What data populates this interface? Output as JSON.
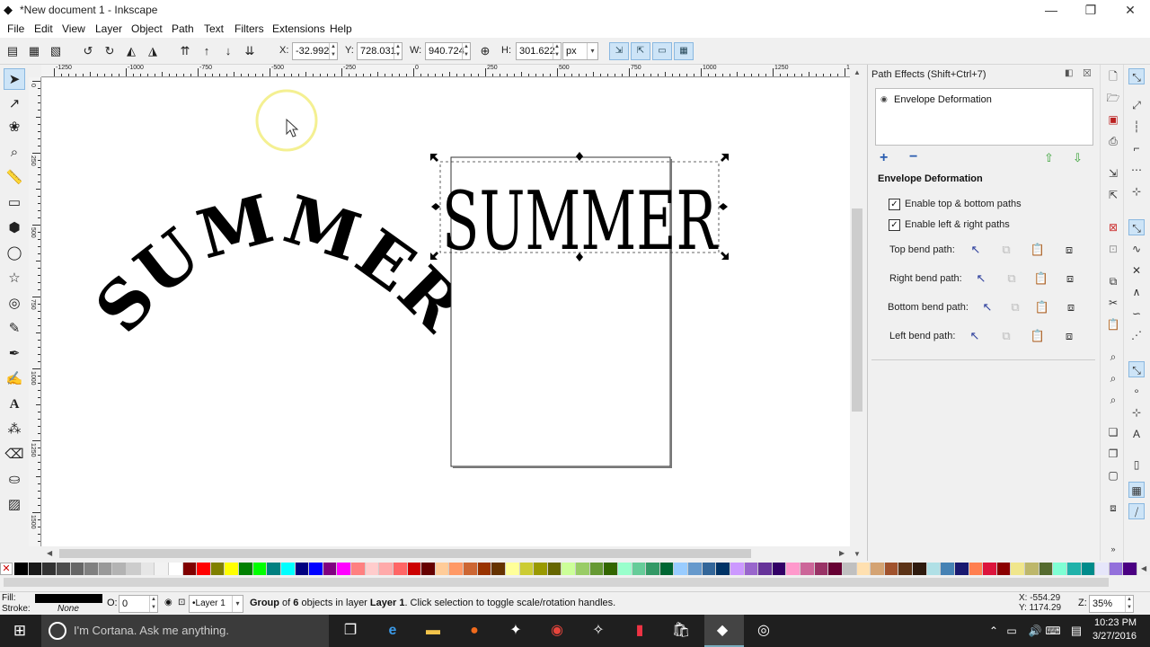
{
  "window": {
    "title": "*New document 1 - Inkscape",
    "minimize": "—",
    "restore": "❐",
    "close": "✕"
  },
  "menu": [
    "File",
    "Edit",
    "View",
    "Layer",
    "Object",
    "Path",
    "Text",
    "Filters",
    "Extensions",
    "Help"
  ],
  "toolbar": {
    "x_label": "X:",
    "x_value": "-32.992",
    "y_label": "Y:",
    "y_value": "728.031",
    "w_label": "W:",
    "w_value": "940.724",
    "h_label": "H:",
    "h_value": "301.622",
    "unit": "px"
  },
  "ruler": {
    "h_labels": [
      "-1250",
      "-1000",
      "-750",
      "-500",
      "-250",
      "0",
      "250",
      "500",
      "750",
      "1000",
      "1250",
      "1500",
      "1750"
    ],
    "v_labels": [
      "0",
      "250",
      "500",
      "750",
      "1000",
      "1250",
      "1500"
    ]
  },
  "canvas": {
    "text_arched": "SUMMER",
    "text_envelope": "SUMMER"
  },
  "panel": {
    "title": "Path Effects  (Shift+Ctrl+7)",
    "effect_item": "Envelope Deformation",
    "section_title": "Envelope Deformation",
    "enable_top_bottom": "Enable top & bottom paths",
    "enable_left_right": "Enable left & right paths",
    "top_bend": "Top bend path:",
    "right_bend": "Right bend path:",
    "bottom_bend": "Bottom bend path:",
    "left_bend": "Left bend path:"
  },
  "palette": [
    "#000000",
    "#1a1a1a",
    "#333333",
    "#4d4d4d",
    "#666666",
    "#808080",
    "#999999",
    "#b3b3b3",
    "#cccccc",
    "#e6e6e6",
    "#f2f2f2",
    "#ffffff",
    "#800000",
    "#ff0000",
    "#808000",
    "#ffff00",
    "#008000",
    "#00ff00",
    "#008080",
    "#00ffff",
    "#000080",
    "#0000ff",
    "#800080",
    "#ff00ff",
    "#ff8080",
    "#ffcccc",
    "#ffaaaa",
    "#ff6666",
    "#cc0000",
    "#660000",
    "#ffcc99",
    "#ff9966",
    "#cc6633",
    "#993300",
    "#663300",
    "#ffff99",
    "#cccc33",
    "#999900",
    "#666600",
    "#ccff99",
    "#99cc66",
    "#669933",
    "#336600",
    "#99ffcc",
    "#66cc99",
    "#339966",
    "#006633",
    "#99ccff",
    "#6699cc",
    "#336699",
    "#003366",
    "#cc99ff",
    "#9966cc",
    "#663399",
    "#330066",
    "#ff99cc",
    "#cc6699",
    "#993366",
    "#660033",
    "#c0c0c0",
    "#ffe0b0",
    "#d4a373",
    "#a0522d",
    "#5c3317",
    "#2e1a0e",
    "#b0e0e6",
    "#4682b4",
    "#191970",
    "#ff7f50",
    "#dc143c",
    "#8b0000",
    "#f0e68c",
    "#bdb76b",
    "#556b2f",
    "#7fffd4",
    "#20b2aa",
    "#008b8b",
    "#e6e6fa",
    "#9370db",
    "#4b0082"
  ],
  "status": {
    "fill_label": "Fill:",
    "stroke_label": "Stroke:",
    "stroke_value": "None",
    "opacity_label": "O:",
    "opacity_value": "0",
    "layer": "•Layer 1",
    "msg_part1": "Group",
    "msg_part2": " of ",
    "msg_count": "6",
    "msg_part3": " objects in layer ",
    "msg_layer": "Layer 1",
    "msg_part4": ". Click selection to toggle scale/rotation handles.",
    "coord_x": "X: -554.29",
    "coord_y": "Y: 1174.29",
    "zoom_label": "Z:",
    "zoom_value": "35%"
  },
  "taskbar": {
    "search_placeholder": "I'm Cortana. Ask me anything.",
    "time": "10:23 PM",
    "date": "3/27/2016"
  }
}
